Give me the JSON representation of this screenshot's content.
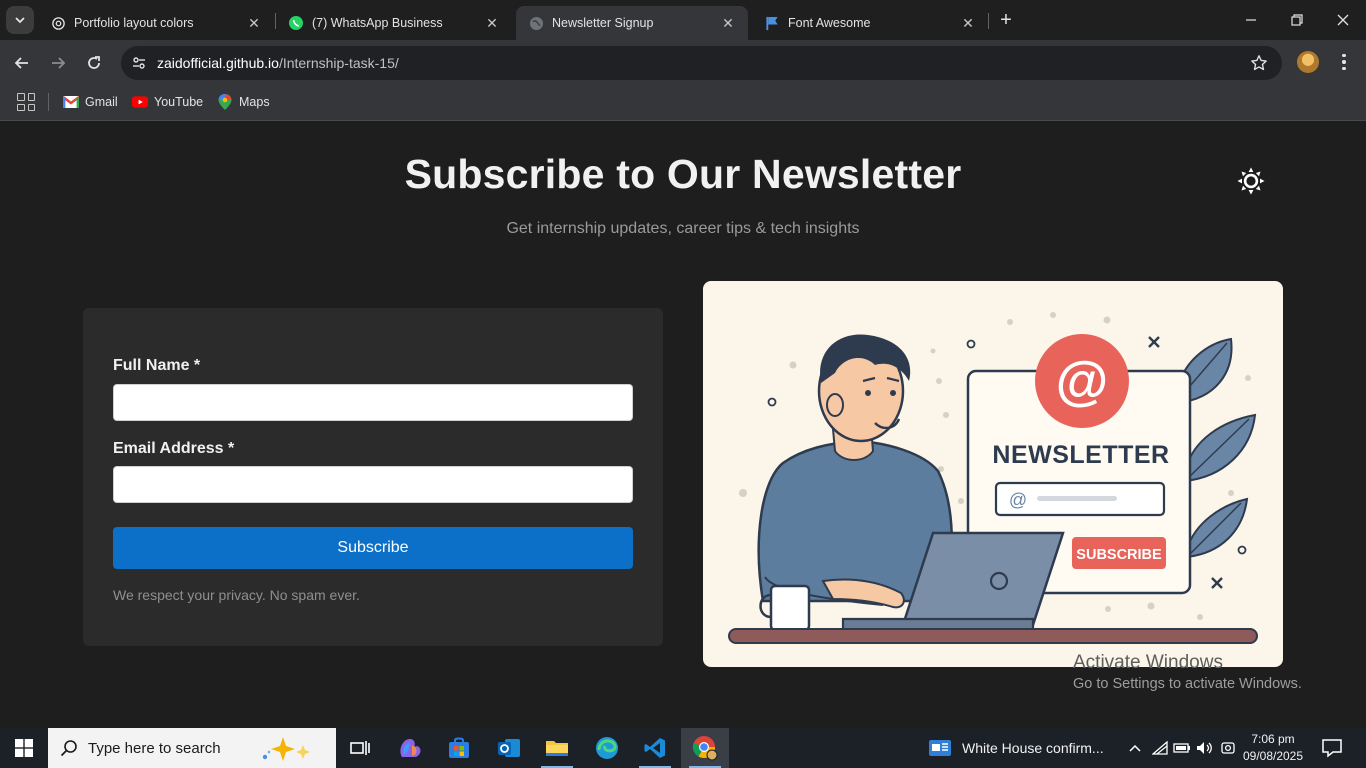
{
  "browser": {
    "tabs": [
      {
        "title": "Portfolio layout colors",
        "icon": "openai-icon",
        "active": false
      },
      {
        "title": "(7) WhatsApp Business",
        "icon": "whatsapp-icon",
        "active": false
      },
      {
        "title": "Newsletter Signup",
        "icon": "globe-icon",
        "active": true
      },
      {
        "title": "Font Awesome",
        "icon": "flag-icon",
        "active": false
      }
    ],
    "url": {
      "host": "zaidofficial.github.io",
      "path": "/Internship-task-15/"
    },
    "bookmarks": [
      {
        "label": "Gmail",
        "icon": "gmail-icon"
      },
      {
        "label": "YouTube",
        "icon": "youtube-icon"
      },
      {
        "label": "Maps",
        "icon": "maps-icon"
      }
    ]
  },
  "page": {
    "headline": "Subscribe to Our Newsletter",
    "subheadline": "Get internship updates, career tips & tech insights",
    "theme_toggle_icon": "sun-icon",
    "form": {
      "name_label": "Full Name *",
      "name_value": "",
      "email_label": "Email Address *",
      "email_value": "",
      "submit_label": "Subscribe",
      "privacy_note": "We respect your privacy. No spam ever."
    },
    "illustration": {
      "newsletter_text": "NEWSLETTER",
      "button_text": "SUBSCRIBE",
      "at_symbol": "@"
    }
  },
  "watermark": {
    "line1": "Activate Windows",
    "line2": "Go to Settings to activate Windows."
  },
  "taskbar": {
    "search_placeholder": "Type here to search",
    "news_text": "White House confirm...",
    "time": "7:06 pm",
    "date": "09/08/2025"
  },
  "colors": {
    "accent_button": "#0c70c8",
    "page_bg": "#1e1e1e",
    "card_bg": "#2b2b2b",
    "illustration_bg": "#fbf5ea",
    "badge_red": "#e8645a"
  }
}
